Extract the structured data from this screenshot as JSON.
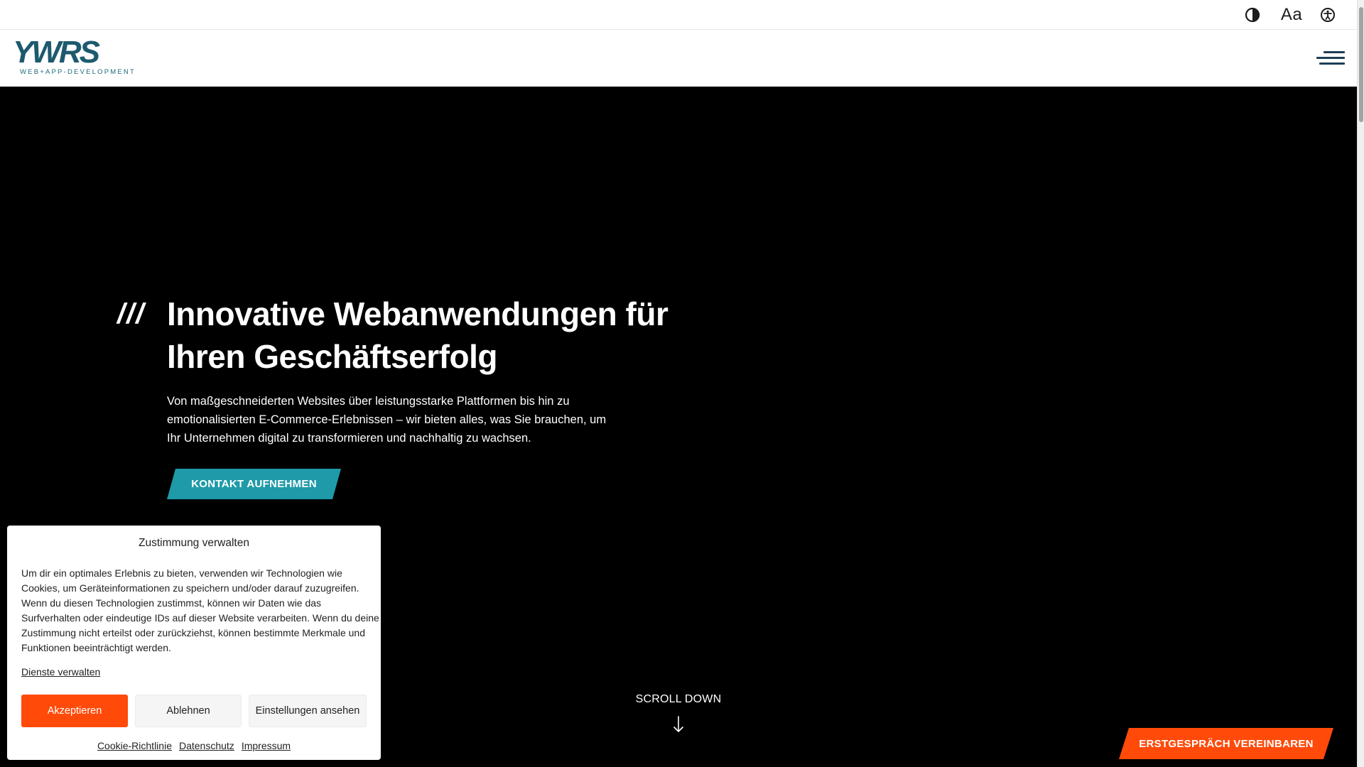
{
  "utility_bar": {
    "icons": [
      "contrast-icon",
      "font-size-icon",
      "accessibility-icon"
    ],
    "font_size_glyph": "Aa"
  },
  "header": {
    "logo_mark": "YWRS",
    "logo_subtitle": "WEB+APP-DEVELOPMENT",
    "menu_icon": "hamburger-menu-icon"
  },
  "hero": {
    "slashes": "///",
    "title_lines": [
      "Innovative Webanwendungen für",
      "Ihren Geschäftserfolg"
    ],
    "text_lines": [
      "Von maßgeschneiderten Websites über leistungsstarke Plattformen bis hin zu",
      "emotionalisierten E-Commerce-Erlebnissen – wir bieten alles, was Sie brauchen, um",
      "Ihr Unternehmen digital zu transformieren und nachhaltig zu wachsen."
    ],
    "cta_label": "KONTAKT AUFNEHMEN",
    "scroll_label": "SCROLL DOWN",
    "appointment_label": "ERSTGESPRÄCH VEREINBAREN"
  },
  "cookie": {
    "title": "Zustimmung verwalten",
    "body_lines": [
      "Um dir ein optimales Erlebnis zu bieten, verwenden wir Technologien wie",
      "Cookies, um Geräteinformationen zu speichern und/oder darauf zuzugreifen.",
      "Wenn du diesen Technologien zustimmst, können wir Daten wie das",
      "Surfverhalten oder eindeutige IDs auf dieser Website verarbeiten. Wenn du deine",
      "Zustimmung nicht erteilst oder zurückziehst, können bestimmte Merkmale und",
      "Funktionen beeinträchtigt werden."
    ],
    "manage_link": "Dienste verwalten",
    "accept_label": "Akzeptieren",
    "deny_label": "Ablehnen",
    "settings_label": "Einstellungen ansehen",
    "footer_links": [
      "Cookie-Richtlinie",
      "Datenschutz",
      "Impressum"
    ]
  },
  "colors": {
    "accent_teal": "#1e9aa8",
    "accent_orange": "#ff4a0a",
    "logo_blue": "#1d5a6e",
    "hero_bg": "#000000"
  }
}
